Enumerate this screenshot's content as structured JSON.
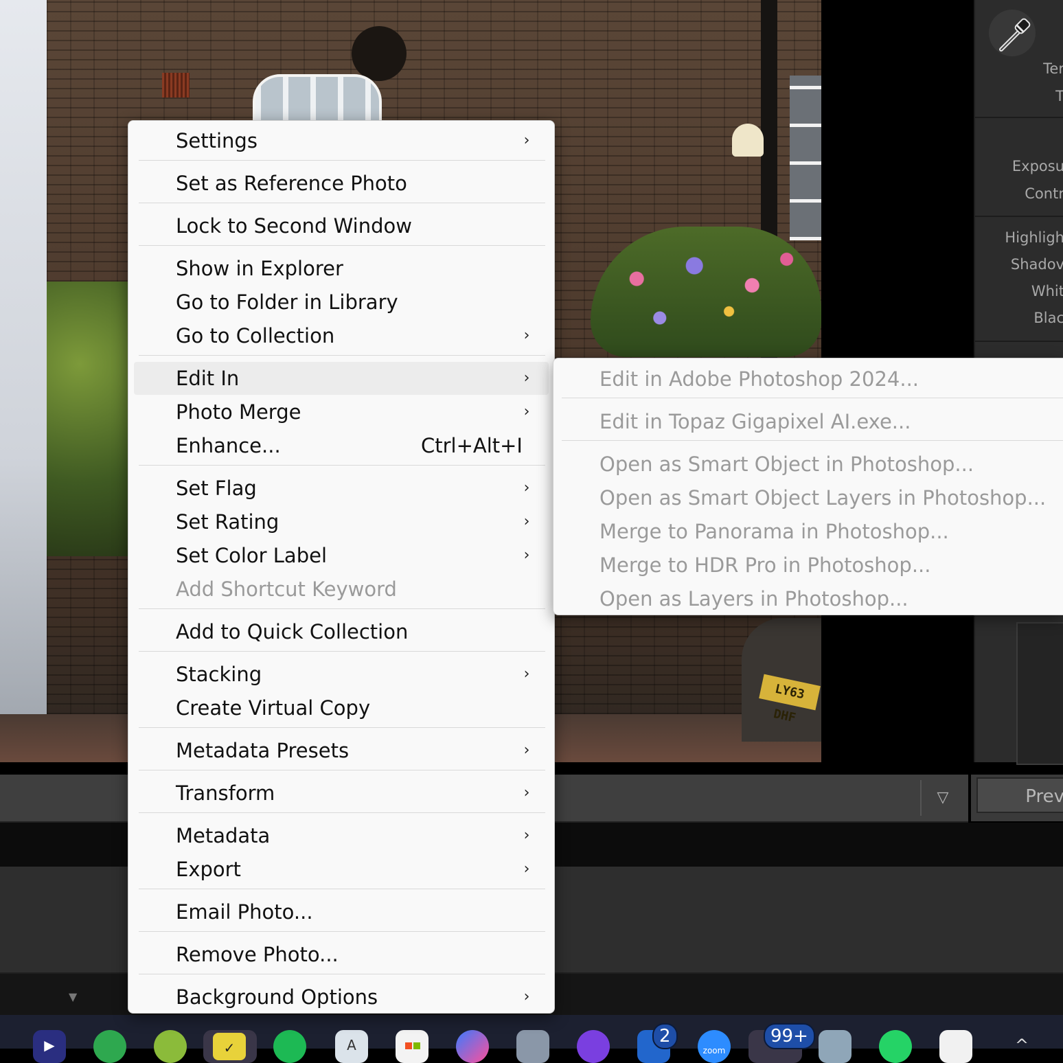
{
  "context_menu": {
    "settings": "Settings",
    "set_reference": "Set as Reference Photo",
    "lock_second_window": "Lock to Second Window",
    "show_in_explorer": "Show in Explorer",
    "go_to_folder": "Go to Folder in Library",
    "go_to_collection": "Go to Collection",
    "edit_in": "Edit In",
    "photo_merge": "Photo Merge",
    "enhance": "Enhance...",
    "enhance_shortcut": "Ctrl+Alt+I",
    "set_flag": "Set Flag",
    "set_rating": "Set Rating",
    "set_color_label": "Set Color Label",
    "add_shortcut_keyword": "Add Shortcut Keyword",
    "add_quick_collection": "Add to Quick Collection",
    "stacking": "Stacking",
    "create_virtual_copy": "Create Virtual Copy",
    "metadata_presets": "Metadata Presets",
    "transform": "Transform",
    "metadata": "Metadata",
    "export": "Export",
    "email_photo": "Email Photo...",
    "remove_photo": "Remove Photo...",
    "background_options": "Background Options",
    "arrow_glyph": "›"
  },
  "edit_in_submenu": {
    "photoshop_2024": "Edit in Adobe Photoshop 2024...",
    "topaz": "Edit in Topaz Gigapixel AI.exe...",
    "smart_object": "Open as Smart Object in Photoshop...",
    "smart_object_layers": "Open as Smart Object Layers in Photoshop...",
    "panorama": "Merge to Panorama in Photoshop...",
    "hdr_pro": "Merge to HDR Pro in Photoshop...",
    "layers": "Open as Layers in Photoshop..."
  },
  "right_panel": {
    "temp": "Ter",
    "tint": "T",
    "exposure": "Exposu",
    "contrast": "Contr",
    "highlights": "Highligh",
    "shadows": "Shadov",
    "whites": "Whit",
    "blacks": "Blac",
    "prev_button": "Prev"
  },
  "photo": {
    "plate_text": "LY63 DHF"
  },
  "toolbar": {
    "dropdown_glyph": "▽"
  },
  "taskbar": {
    "badge_2": "2",
    "badge_99": "99+",
    "zoom_label": "zoom",
    "chevron": "^"
  },
  "colors": {
    "menu_bg": "#f9f9f9",
    "menu_text": "#111111",
    "menu_disabled": "#9a9a9a",
    "panel_bg": "#2c2c2c",
    "taskbar_bg": "#1c2030"
  }
}
